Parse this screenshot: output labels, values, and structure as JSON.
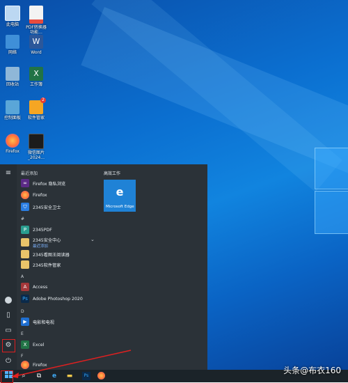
{
  "desktop": {
    "icons": [
      {
        "label": "此电脑",
        "name": "this-pc-icon",
        "color": "#bcd8f2"
      },
      {
        "label": "PDF转换器\n功能...",
        "name": "pdf-converter-icon",
        "color": "#e94c3d"
      },
      {
        "label": "网络",
        "name": "network-icon",
        "color": "#3f8fd8"
      },
      {
        "label": "Word",
        "name": "word-icon",
        "color": "#2b579a"
      },
      {
        "label": "回收站",
        "name": "recycle-bin-icon",
        "color": "#8fb7d8"
      },
      {
        "label": "工作簿",
        "name": "excel-workbook-icon",
        "color": "#217346"
      },
      {
        "label": "控制面板",
        "name": "control-panel-icon",
        "color": "#5aa6d8"
      },
      {
        "label": "软件管家",
        "name": "software-manager-icon",
        "color": "#f5a623"
      },
      {
        "label": "Firefox",
        "name": "firefox-icon",
        "color": "#ff7139"
      },
      {
        "label": "微信图片\n_2024...",
        "name": "image-file-icon",
        "color": "#1c1c1c"
      }
    ]
  },
  "start_menu": {
    "recent_header": "最近添加",
    "recent_apps": [
      {
        "label": "Firefox 隐私浏览",
        "icon": "firefox-private-icon",
        "color": "#5b2a86"
      },
      {
        "label": "Firefox",
        "icon": "firefox-icon",
        "color": "#ff7139"
      },
      {
        "label": "2345安全卫士",
        "icon": "shield-icon",
        "color": "#2a7de1"
      }
    ],
    "groups": [
      {
        "letter": "#",
        "apps": [
          {
            "label": "2345PDF",
            "icon": "pdf-icon",
            "color": "#2a9d8f"
          },
          {
            "label": "2345安全中心",
            "icon": "folder-icon",
            "color": "#e9c46a",
            "sub": "最近添加",
            "expandable": true
          },
          {
            "label": "2345看图王阅读器",
            "icon": "folder-icon",
            "color": "#e9c46a"
          },
          {
            "label": "2345软件管家",
            "icon": "folder-icon",
            "color": "#e9c46a"
          }
        ]
      },
      {
        "letter": "A",
        "apps": [
          {
            "label": "Access",
            "icon": "access-icon",
            "color": "#a4373a"
          },
          {
            "label": "Adobe Photoshop 2020",
            "icon": "photoshop-icon",
            "color": "#0b2a4a"
          }
        ]
      },
      {
        "letter": "D",
        "apps": [
          {
            "label": "电影和电视",
            "icon": "movies-icon",
            "color": "#1f6fd1"
          }
        ]
      },
      {
        "letter": "E",
        "apps": [
          {
            "label": "Excel",
            "icon": "excel-icon",
            "color": "#217346"
          }
        ]
      },
      {
        "letter": "F",
        "apps": [
          {
            "label": "Firefox",
            "icon": "firefox-icon",
            "color": "#ff7139"
          }
        ]
      }
    ],
    "tiles_header": "高效工作",
    "tile": {
      "label": "Microsoft Edge",
      "glyph": "e"
    }
  },
  "taskbar": {
    "items": [
      "start-button",
      "search-icon",
      "task-view-icon",
      "edge-icon",
      "explorer-icon",
      "photoshop-icon",
      "firefox-icon"
    ]
  },
  "watermark": "头条@布衣160",
  "colors": {
    "highlight": "#e02020",
    "accent": "#1f82d6"
  }
}
